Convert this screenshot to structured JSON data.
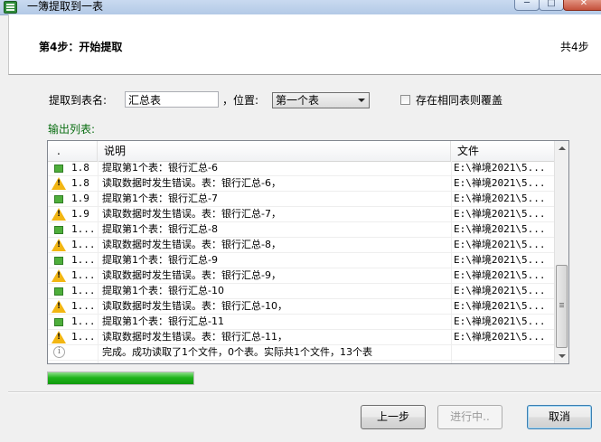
{
  "window": {
    "title": "一簿提取到一表",
    "minimize": "─",
    "maximize": "□",
    "close": "✕"
  },
  "header": {
    "step_title": "第4步：开始提取",
    "step_total": "共4步"
  },
  "form": {
    "extract_label": "提取到表名:",
    "sheet_name_value": "汇总表",
    "position_label": "，位置:",
    "position_value": "第一个表",
    "overwrite_label": "存在相同表则覆盖",
    "overwrite_checked": false,
    "output_label": "输出列表:"
  },
  "list": {
    "columns": [
      ".",
      "说明",
      "文件"
    ],
    "rows": [
      {
        "icon": "ok",
        "step": "1.8",
        "desc": "提取第1个表：银行汇总-6",
        "file": "E:\\禅境2021\\5..."
      },
      {
        "icon": "warn",
        "step": "1.8",
        "desc": "读取数据时发生错误。表：银行汇总-6，",
        "file": "E:\\禅境2021\\5..."
      },
      {
        "icon": "ok",
        "step": "1.9",
        "desc": "提取第1个表：银行汇总-7",
        "file": "E:\\禅境2021\\5..."
      },
      {
        "icon": "warn",
        "step": "1.9",
        "desc": "读取数据时发生错误。表：银行汇总-7，",
        "file": "E:\\禅境2021\\5..."
      },
      {
        "icon": "ok",
        "step": "1...",
        "desc": "提取第1个表：银行汇总-8",
        "file": "E:\\禅境2021\\5..."
      },
      {
        "icon": "warn",
        "step": "1...",
        "desc": "读取数据时发生错误。表：银行汇总-8，",
        "file": "E:\\禅境2021\\5..."
      },
      {
        "icon": "ok",
        "step": "1...",
        "desc": "提取第1个表：银行汇总-9",
        "file": "E:\\禅境2021\\5..."
      },
      {
        "icon": "warn",
        "step": "1...",
        "desc": "读取数据时发生错误。表：银行汇总-9，",
        "file": "E:\\禅境2021\\5..."
      },
      {
        "icon": "ok",
        "step": "1...",
        "desc": "提取第1个表：银行汇总-10",
        "file": "E:\\禅境2021\\5..."
      },
      {
        "icon": "warn",
        "step": "1...",
        "desc": "读取数据时发生错误。表：银行汇总-10，",
        "file": "E:\\禅境2021\\5..."
      },
      {
        "icon": "ok",
        "step": "1...",
        "desc": "提取第1个表：银行汇总-11",
        "file": "E:\\禅境2021\\5..."
      },
      {
        "icon": "warn",
        "step": "1...",
        "desc": "读取数据时发生错误。表：银行汇总-11，",
        "file": "E:\\禅境2021\\5..."
      },
      {
        "icon": "info",
        "step": "",
        "desc": "完成。成功读取了1个文件，0个表。实际共1个文件，13个表",
        "file": ""
      }
    ]
  },
  "progress": {
    "fraction": 1.0
  },
  "footer": {
    "prev_label": "上一步",
    "next_label": "进行中..",
    "cancel_label": "取消"
  },
  "colors": {
    "ok_icon": "#4eae3b",
    "warn_icon": "#f2b613",
    "progress": "#20b41c",
    "output_label": "#0a6e12"
  }
}
